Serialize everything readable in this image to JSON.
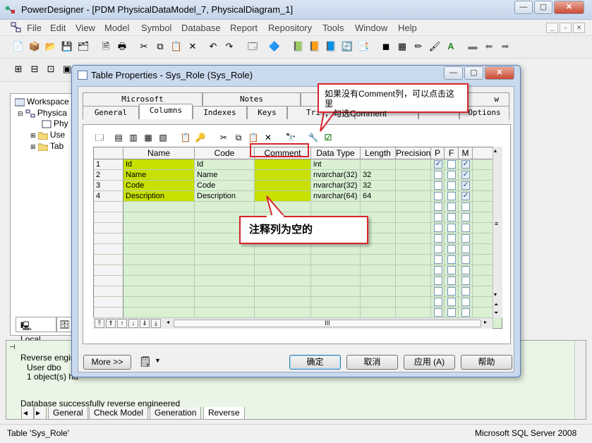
{
  "app": {
    "title": "PowerDesigner - [PDM PhysicalDataModel_7, PhysicalDiagram_1]",
    "menu": [
      "File",
      "Edit",
      "View",
      "Model",
      "Symbol",
      "Database",
      "Report",
      "Repository",
      "Tools",
      "Window",
      "Help"
    ]
  },
  "browser": {
    "items": [
      "Workspace",
      "Physica",
      "Phy",
      "Use",
      "Tab"
    ],
    "tabs": [
      "Local",
      ""
    ]
  },
  "output": {
    "lines": [
      "Reverse engine",
      "User dbo",
      "1 object(s) ha",
      "Database successfully reverse engineered"
    ],
    "tabs": [
      "General",
      "Check Model",
      "Generation",
      "Reverse"
    ]
  },
  "status": {
    "left": "Table 'Sys_Role'",
    "right": "Microsoft SQL Server 2008"
  },
  "dialog": {
    "title": "Table Properties - Sys_Role (Sys_Role)",
    "tabs_top": [
      "Microsoft",
      "Notes",
      "",
      "",
      "",
      "w"
    ],
    "tabs_bottom": [
      "General",
      "Columns",
      "Indexes",
      "Keys",
      "Tri",
      "",
      "",
      "Options"
    ],
    "grid": {
      "headers": [
        "Name",
        "Code",
        "Comment",
        "Data Type",
        "Length",
        "Precision",
        "P",
        "F",
        "M"
      ],
      "rows": [
        {
          "num": "1",
          "name": "Id",
          "code": "Id",
          "comment": "",
          "type": "int",
          "length": "",
          "precision": "",
          "p": true,
          "f": false,
          "m": true
        },
        {
          "num": "2",
          "name": "Name",
          "code": "Name",
          "comment": "",
          "type": "nvarchar(32)",
          "length": "32",
          "precision": "",
          "p": false,
          "f": false,
          "m": true
        },
        {
          "num": "3",
          "name": "Code",
          "code": "Code",
          "comment": "",
          "type": "nvarchar(32)",
          "length": "32",
          "precision": "",
          "p": false,
          "f": false,
          "m": true
        },
        {
          "num": "4",
          "name": "Description",
          "code": "Description",
          "comment": "",
          "type": "nvarchar(64)",
          "length": "64",
          "precision": "",
          "p": false,
          "f": false,
          "m": true
        }
      ],
      "hscroll_label": "III"
    },
    "buttons": {
      "more": "More >>",
      "ok": "确定",
      "cancel": "取消",
      "apply": "应用 (A)",
      "help": "帮助"
    }
  },
  "annotations": {
    "tip": "如果没有Comment列，可以点击这里\n，勾选Comment",
    "empty_note": "注释列为空的"
  }
}
